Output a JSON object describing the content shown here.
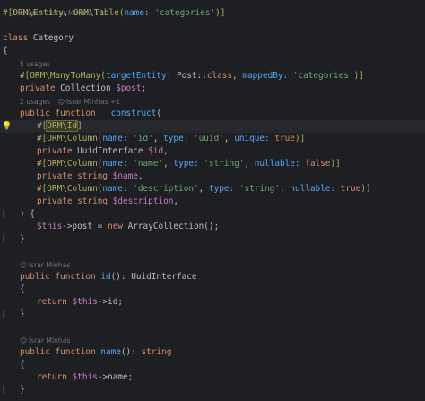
{
  "hints": {
    "top": "2 usages  · Israr Minhas +1",
    "property": "5 usages",
    "constructor_usages": "2 usages",
    "constructor_author": "Israr Minhas +1",
    "author": "Israr Minhas"
  },
  "code": {
    "table_attr_open": "#[ORM\\Entity, ORM\\Table(",
    "name_param": "name:",
    "table_name": "'categories'",
    "close_bracket_paren": ")]",
    "class_kw": "class",
    "class_name": " Category",
    "open_brace": "{",
    "close_brace": "}",
    "m2m_open": "#[ORM\\ManyToMany(",
    "target_entity": "targetEntity:",
    "post_class": " Post::",
    "class_const": "class",
    "comma": ",",
    "comma_space": ", ",
    "mapped_by": "mappedBy:",
    "categories_str": " 'categories'",
    "private_kw": "private",
    "collection_type": " Collection ",
    "post_var": "$post",
    "semicolon": ";",
    "public_kw": "public",
    "function_kw": " function ",
    "construct_name": "__construct",
    "open_paren": "(",
    "id_attr_prefix": "#[",
    "id_attr_name": "ORM\\Id",
    "id_attr_suffix": "]",
    "column_open": "#[ORM\\Column(",
    "id_str": " 'id'",
    "type_param": "type:",
    "uuid_str": " 'uuid'",
    "unique_param": "unique:",
    "true_kw": " true",
    "false_kw": " false",
    "uuid_type": " UuidInterface ",
    "id_var": "$id",
    "name_str": " 'name'",
    "string_str": " 'string'",
    "nullable_param": "nullable:",
    "string_kw": " string ",
    "name_var": "$name",
    "description_str": " 'description'",
    "description_var": "$description",
    "close_paren_brace": ") {",
    "this_var": "$this",
    "arrow_post": "->post = ",
    "new_kw": "new",
    "array_collection": " ArrayCollection();",
    "id_fn": "id",
    "id_sig": "(): UuidInterface",
    "return_kw": "return",
    "this_id": "->id;",
    "name_fn": "name",
    "name_sig": "(): ",
    "string_ret": "string",
    "this_name": "->name;"
  },
  "icons": {
    "bulb": "lightbulb-icon",
    "person": "person-icon",
    "fold": "fold-marker-icon"
  }
}
